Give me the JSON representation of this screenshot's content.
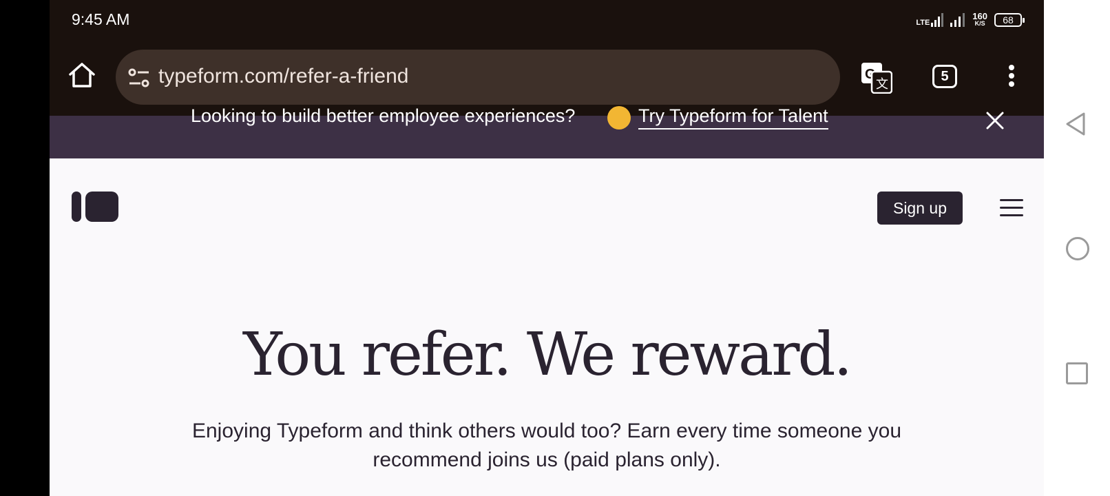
{
  "status_bar": {
    "time": "9:45 AM",
    "network": "LTE",
    "speed_value": "160",
    "speed_unit": "K/S",
    "battery": "68"
  },
  "browser": {
    "url": "typeform.com/refer-a-friend",
    "tab_count": "5"
  },
  "banner": {
    "text": "Looking to build better employee experiences?",
    "link": "Try Typeform for Talent"
  },
  "header": {
    "signup_label": "Sign up"
  },
  "hero": {
    "title": "You refer. We reward.",
    "subtitle": "Enjoying Typeform and think others would too? Earn every time someone you recommend joins us (paid plans only)."
  },
  "colors": {
    "brand_dark": "#2a2330",
    "banner_bg": "#3d3045",
    "page_bg": "#faf9fb",
    "browser_chrome": "#1a110d"
  }
}
